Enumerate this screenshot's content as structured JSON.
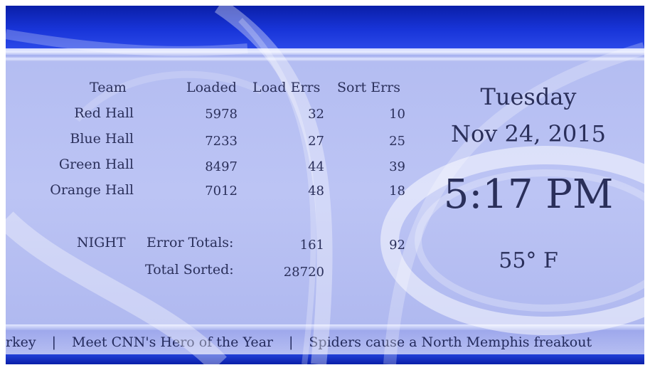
{
  "table": {
    "headers": {
      "team": "Team",
      "loaded": "Loaded",
      "load_errs": "Load Errs",
      "sort_errs": "Sort Errs"
    },
    "rows": [
      {
        "team": "Red Hall",
        "loaded": "5978",
        "load_errs": "32",
        "sort_errs": "10"
      },
      {
        "team": "Blue Hall",
        "loaded": "7233",
        "load_errs": "27",
        "sort_errs": "25"
      },
      {
        "team": "Green Hall",
        "loaded": "8497",
        "load_errs": "44",
        "sort_errs": "39"
      },
      {
        "team": "Orange Hall",
        "loaded": "7012",
        "load_errs": "48",
        "sort_errs": "18"
      }
    ]
  },
  "summary": {
    "shift": "NIGHT",
    "error_totals_label": "Error Totals:",
    "error_totals_load": "161",
    "error_totals_sort": "92",
    "total_sorted_label": "Total Sorted:",
    "total_sorted_value": "28720"
  },
  "clock": {
    "day": "Tuesday",
    "date": "Nov 24, 2015",
    "time": "5:17 PM",
    "temperature": "55° F"
  },
  "ticker": {
    "items": [
      "rkey",
      "Meet CNN's Hero of the Year",
      "Spiders cause a North Memphis freakout"
    ],
    "separator": "|"
  },
  "colors": {
    "band_blue": "#0a1fa8",
    "panel_lavender": "#b8c0f0",
    "text_navy": "#2a2f5a"
  }
}
